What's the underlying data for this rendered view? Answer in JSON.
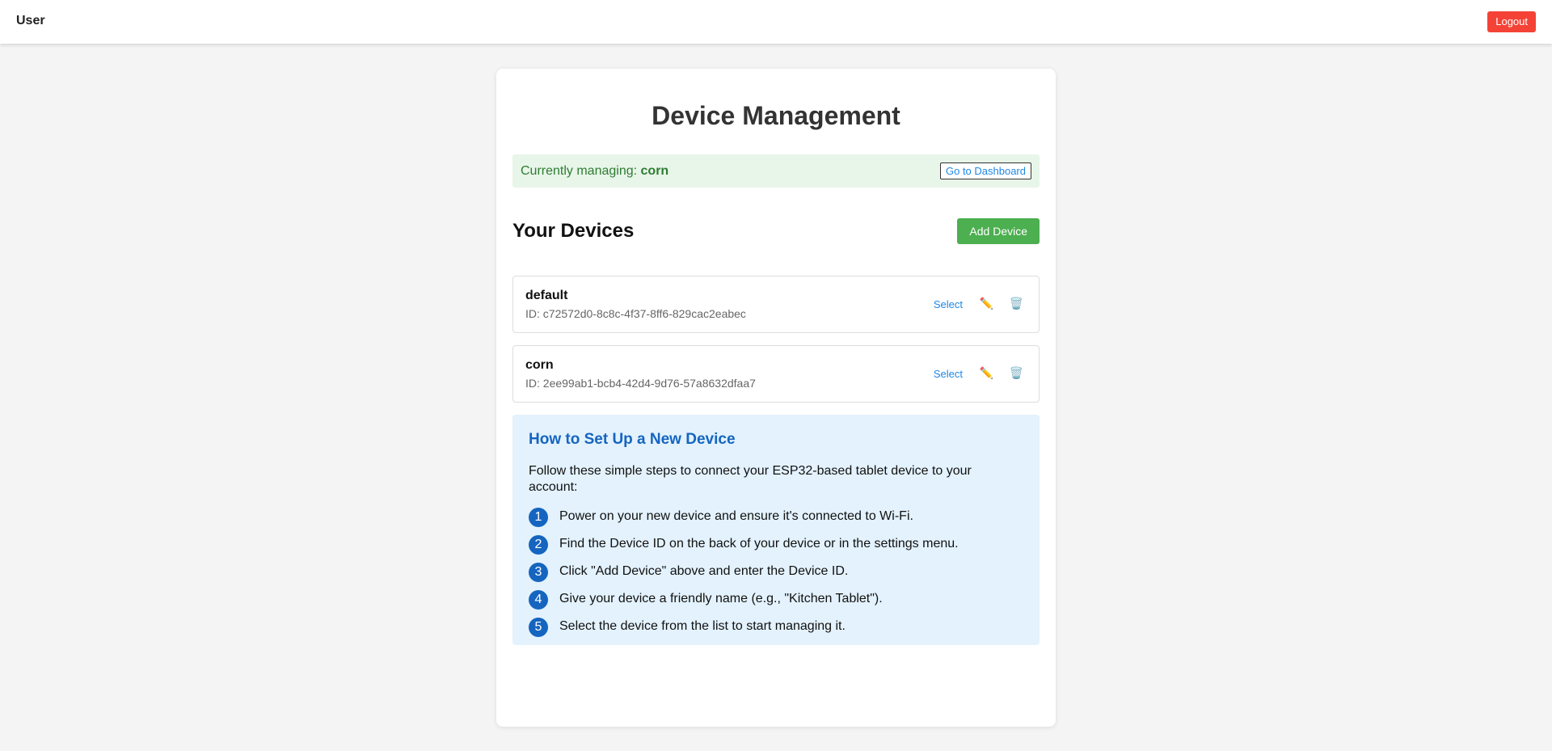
{
  "header": {
    "user_label": "User",
    "logout_label": "Logout"
  },
  "main": {
    "title": "Device Management",
    "managing": {
      "prefix": "Currently managing: ",
      "device_name": "corn",
      "dashboard_label": "Go to Dashboard"
    },
    "devices_heading": "Your Devices",
    "add_device_label": "Add Device",
    "devices": [
      {
        "name": "default",
        "id_text": "ID: c72572d0-8c8c-4f37-8ff6-829cac2eabec",
        "select_label": "Select",
        "edit_icon": "✏️",
        "delete_icon": "🗑️"
      },
      {
        "name": "corn",
        "id_text": "ID: 2ee99ab1-bcb4-42d4-9d76-57a8632dfaa7",
        "select_label": "Select",
        "edit_icon": "✏️",
        "delete_icon": "🗑️"
      }
    ],
    "help": {
      "title": "How to Set Up a New Device",
      "intro": "Follow these simple steps to connect your ESP32-based tablet device to your account:",
      "steps": [
        {
          "num": "1",
          "text": "Power on your new device and ensure it's connected to Wi-Fi."
        },
        {
          "num": "2",
          "text": "Find the Device ID on the back of your device or in the settings menu."
        },
        {
          "num": "3",
          "text": "Click \"Add Device\" above and enter the Device ID."
        },
        {
          "num": "4",
          "text": "Give your device a friendly name (e.g., \"Kitchen Tablet\")."
        },
        {
          "num": "5",
          "text": "Select the device from the list to start managing it."
        }
      ]
    }
  },
  "colors": {
    "logout": "#f44336",
    "add_device": "#4caf50",
    "managing_bg": "#e8f5e9",
    "managing_text": "#2e7d32",
    "help_bg": "#e3f2fd",
    "help_accent": "#1565c0",
    "link": "#1e88e5"
  }
}
